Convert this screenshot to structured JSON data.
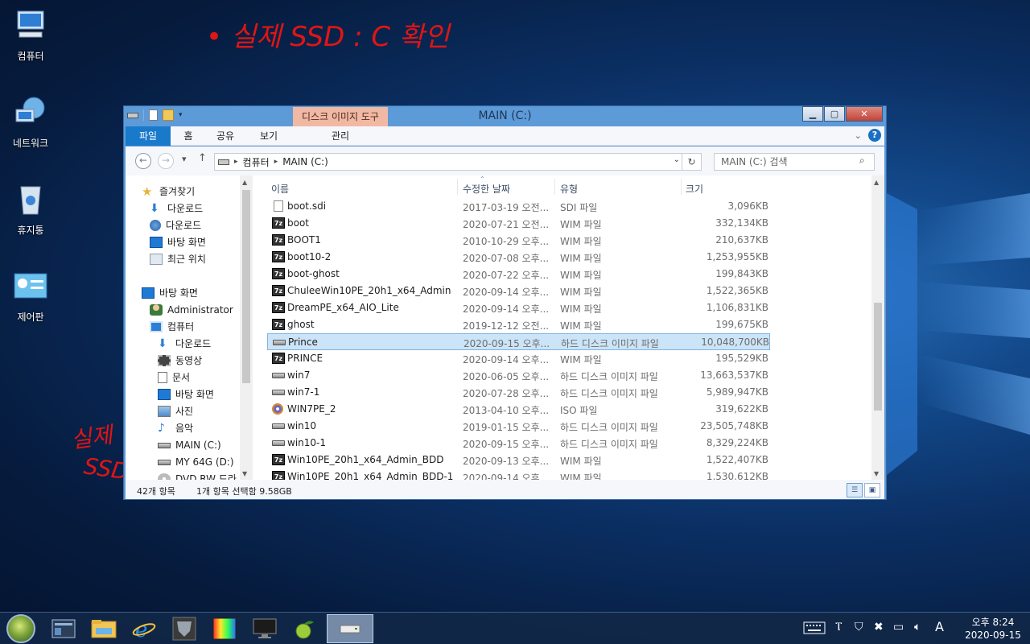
{
  "desktop": {
    "icons": [
      {
        "label": "컴퓨터",
        "icon": "computer-icon"
      },
      {
        "label": "네트워크",
        "icon": "network-icon"
      },
      {
        "label": "휴지통",
        "icon": "recycle-bin-icon"
      },
      {
        "label": "제어판",
        "icon": "control-panel-icon"
      }
    ],
    "annotations": {
      "top_note": "• 실제 SSD : C 확인",
      "side_note_line1": "실제",
      "side_note_line2": "SSD"
    }
  },
  "window": {
    "title": "MAIN (C:)",
    "context_tab": "디스크 이미지 도구",
    "ribbon_tabs": [
      "파일",
      "홈",
      "공유",
      "보기",
      "관리"
    ],
    "help_label": "?",
    "address_parts": [
      "컴퓨터",
      "MAIN (C:)"
    ],
    "search_placeholder": "MAIN (C:) 검색",
    "nav_pane": {
      "favorites_header": "즐겨찾기",
      "favorites": [
        "다운로드",
        "다운로드",
        "바탕 화면",
        "최근 위치"
      ],
      "desktop_header": "바탕 화면",
      "desktop_items": [
        "Administrator",
        "컴퓨터"
      ],
      "computer_items": [
        "다운로드",
        "동영상",
        "문서",
        "바탕 화면",
        "사진",
        "음악",
        "MAIN (C:)",
        "MY 64G (D:)",
        "DVD RW 드라"
      ]
    },
    "columns": {
      "name": "이름",
      "date": "수정한 날짜",
      "type": "유형",
      "size": "크기"
    },
    "files": [
      {
        "icon": "doc",
        "name": "boot.sdi",
        "date": "2017-03-19 오전...",
        "type": "SDI 파일",
        "size": "3,096KB"
      },
      {
        "icon": "7z",
        "name": "boot",
        "date": "2020-07-21 오전...",
        "type": "WIM 파일",
        "size": "332,134KB"
      },
      {
        "icon": "7z",
        "name": "BOOT1",
        "date": "2010-10-29 오후...",
        "type": "WIM 파일",
        "size": "210,637KB"
      },
      {
        "icon": "7z",
        "name": "boot10-2",
        "date": "2020-07-08 오후...",
        "type": "WIM 파일",
        "size": "1,253,955KB"
      },
      {
        "icon": "7z",
        "name": "boot-ghost",
        "date": "2020-07-22 오후...",
        "type": "WIM 파일",
        "size": "199,843KB"
      },
      {
        "icon": "7z",
        "name": "ChuleeWin10PE_20h1_x64_Admin",
        "date": "2020-09-14 오후...",
        "type": "WIM 파일",
        "size": "1,522,365KB"
      },
      {
        "icon": "7z",
        "name": "DreamPE_x64_AIO_Lite",
        "date": "2020-09-14 오후...",
        "type": "WIM 파일",
        "size": "1,106,831KB"
      },
      {
        "icon": "7z",
        "name": "ghost",
        "date": "2019-12-12 오전...",
        "type": "WIM 파일",
        "size": "199,675KB"
      },
      {
        "icon": "disk",
        "name": "Prince",
        "date": "2020-09-15 오후...",
        "type": "하드 디스크 이미지 파일",
        "size": "10,048,700KB",
        "selected": true
      },
      {
        "icon": "7z",
        "name": "PRINCE",
        "date": "2020-09-14 오후...",
        "type": "WIM 파일",
        "size": "195,529KB"
      },
      {
        "icon": "disk",
        "name": "win7",
        "date": "2020-06-05 오후...",
        "type": "하드 디스크 이미지 파일",
        "size": "13,663,537KB"
      },
      {
        "icon": "disk",
        "name": "win7-1",
        "date": "2020-07-28 오후...",
        "type": "하드 디스크 이미지 파일",
        "size": "5,989,947KB"
      },
      {
        "icon": "iso",
        "name": "WIN7PE_2",
        "date": "2013-04-10 오후...",
        "type": "ISO 파일",
        "size": "319,622KB"
      },
      {
        "icon": "disk",
        "name": "win10",
        "date": "2019-01-15 오후...",
        "type": "하드 디스크 이미지 파일",
        "size": "23,505,748KB"
      },
      {
        "icon": "disk",
        "name": "win10-1",
        "date": "2020-09-15 오후...",
        "type": "하드 디스크 이미지 파일",
        "size": "8,329,224KB"
      },
      {
        "icon": "7z",
        "name": "Win10PE_20h1_x64_Admin_BDD",
        "date": "2020-09-13 오후...",
        "type": "WIM 파일",
        "size": "1,522,407KB"
      },
      {
        "icon": "7z",
        "name": "Win10PE_20h1_x64_Admin_BDD-1",
        "date": "2020-09-14 오후...",
        "type": "WIM 파일",
        "size": "1,530,612KB"
      }
    ],
    "status": {
      "count": "42개 항목",
      "selection": "1개 항목 선택함 9.58GB"
    }
  },
  "taskbar": {
    "items": [
      "explorer-window-icon",
      "file-explorer-icon",
      "internet-explorer-icon",
      "transformer-icon",
      "color-picker-icon",
      "monitor-icon",
      "green-app-icon",
      "disk-drive-icon"
    ],
    "ime": "A",
    "clock_time": "오후 8:24",
    "clock_date": "2020-09-15"
  },
  "colors": {
    "accent": "#1979ca",
    "selection": "#cce4f7",
    "annotation": "#e01515"
  }
}
